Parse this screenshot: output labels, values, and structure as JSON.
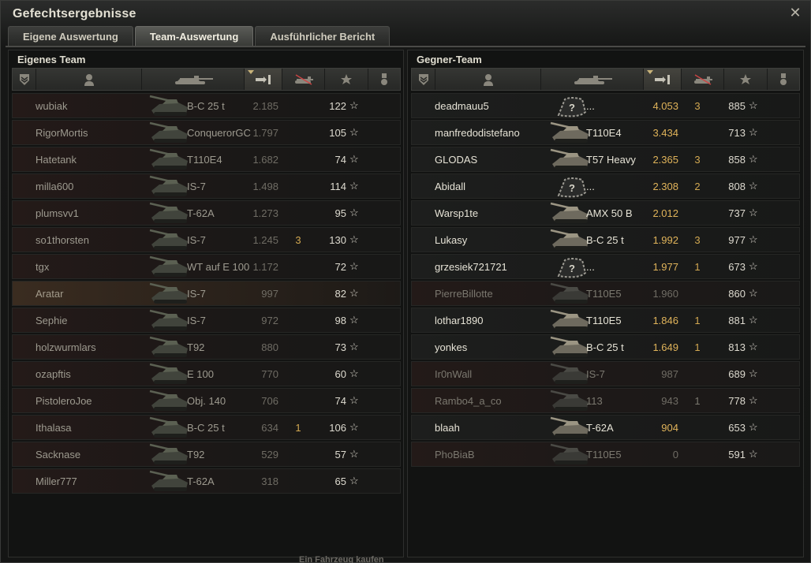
{
  "window": {
    "title": "Gefechtsergebnisse",
    "close_icon": "close-icon"
  },
  "tabs": [
    {
      "label": "Eigene Auswertung",
      "active": false
    },
    {
      "label": "Team-Auswertung",
      "active": true
    },
    {
      "label": "Ausführlicher Bericht",
      "active": false
    }
  ],
  "columns": [
    "rank-icon",
    "player-icon",
    "tank-icon",
    "damage-icon",
    "kills-icon",
    "xp-star-icon",
    "medal-icon"
  ],
  "own_team": {
    "title": "Eigenes Team",
    "rows": [
      {
        "name": "wubiak",
        "vehicle": "B-C 25 t",
        "damage": "2.185",
        "kills": "",
        "xp": "122"
      },
      {
        "name": "RigorMortis",
        "vehicle": "ConquerorGC",
        "damage": "1.797",
        "kills": "",
        "xp": "105"
      },
      {
        "name": "Hatetank",
        "vehicle": "T110E4",
        "damage": "1.682",
        "kills": "",
        "xp": "74"
      },
      {
        "name": "milla600",
        "vehicle": "IS-7",
        "damage": "1.498",
        "kills": "",
        "xp": "114"
      },
      {
        "name": "plumsvv1",
        "vehicle": "T-62A",
        "damage": "1.273",
        "kills": "",
        "xp": "95"
      },
      {
        "name": "so1thorsten",
        "vehicle": "IS-7",
        "damage": "1.245",
        "kills": "3",
        "xp": "130"
      },
      {
        "name": "tgx",
        "vehicle": "WT auf E 100",
        "damage": "1.172",
        "kills": "",
        "xp": "72"
      },
      {
        "name": "Aratar",
        "vehicle": "IS-7",
        "damage": "997",
        "kills": "",
        "xp": "82",
        "me": true
      },
      {
        "name": "Sephie",
        "vehicle": "IS-7",
        "damage": "972",
        "kills": "",
        "xp": "98"
      },
      {
        "name": "holzwurmlars",
        "vehicle": "T92",
        "damage": "880",
        "kills": "",
        "xp": "73"
      },
      {
        "name": "ozapftis",
        "vehicle": "E 100",
        "damage": "770",
        "kills": "",
        "xp": "60"
      },
      {
        "name": "PistoleroJoe",
        "vehicle": "Obj. 140",
        "damage": "706",
        "kills": "",
        "xp": "74"
      },
      {
        "name": "Ithalasa",
        "vehicle": "B-C 25 t",
        "damage": "634",
        "kills": "1",
        "xp": "106"
      },
      {
        "name": "Sacknase",
        "vehicle": "T92",
        "damage": "529",
        "kills": "",
        "xp": "57"
      },
      {
        "name": "Miller777",
        "vehicle": "T-62A",
        "damage": "318",
        "kills": "",
        "xp": "65"
      }
    ]
  },
  "enemy_team": {
    "title": "Gegner-Team",
    "rows": [
      {
        "name": "deadmauu5",
        "vehicle": "...",
        "damage": "4.053",
        "kills": "3",
        "xp": "885",
        "unknown": true
      },
      {
        "name": "manfredodistefano",
        "vehicle": "T110E4",
        "damage": "3.434",
        "kills": "",
        "xp": "713"
      },
      {
        "name": "GLODAS",
        "vehicle": "T57 Heavy",
        "damage": "2.365",
        "kills": "3",
        "xp": "858"
      },
      {
        "name": "Abidall",
        "vehicle": "...",
        "damage": "2.308",
        "kills": "2",
        "xp": "808",
        "unknown": true
      },
      {
        "name": "Warsp1te",
        "vehicle": "AMX 50 B",
        "damage": "2.012",
        "kills": "",
        "xp": "737"
      },
      {
        "name": "Lukasy",
        "vehicle": "B-C 25 t",
        "damage": "1.992",
        "kills": "3",
        "xp": "977"
      },
      {
        "name": "grzesiek721721",
        "vehicle": "...",
        "damage": "1.977",
        "kills": "1",
        "xp": "673",
        "unknown": true
      },
      {
        "name": "PierreBillotte",
        "vehicle": "T110E5",
        "damage": "1.960",
        "kills": "",
        "xp": "860",
        "dead": true
      },
      {
        "name": "lothar1890",
        "vehicle": "T110E5",
        "damage": "1.846",
        "kills": "1",
        "xp": "881"
      },
      {
        "name": "yonkes",
        "vehicle": "B-C 25 t",
        "damage": "1.649",
        "kills": "1",
        "xp": "813"
      },
      {
        "name": "Ir0nWall",
        "vehicle": "IS-7",
        "damage": "987",
        "kills": "",
        "xp": "689",
        "dead": true
      },
      {
        "name": "Rambo4_a_co",
        "vehicle": "113",
        "damage": "943",
        "kills": "1",
        "xp": "778",
        "dead": true
      },
      {
        "name": "blaah",
        "vehicle": "T-62A",
        "damage": "904",
        "kills": "",
        "xp": "653"
      },
      {
        "name": "PhoBiaB",
        "vehicle": "T110E5",
        "damage": "0",
        "kills": "",
        "xp": "591",
        "dead": true
      }
    ]
  },
  "star_glyph": "☆",
  "footer_text": "Ein Fahrzeug kaufen",
  "colors": {
    "accent_gold": "#e0b35a",
    "kills_gold": "#d2a851",
    "own_team_tint": "#241a18"
  }
}
